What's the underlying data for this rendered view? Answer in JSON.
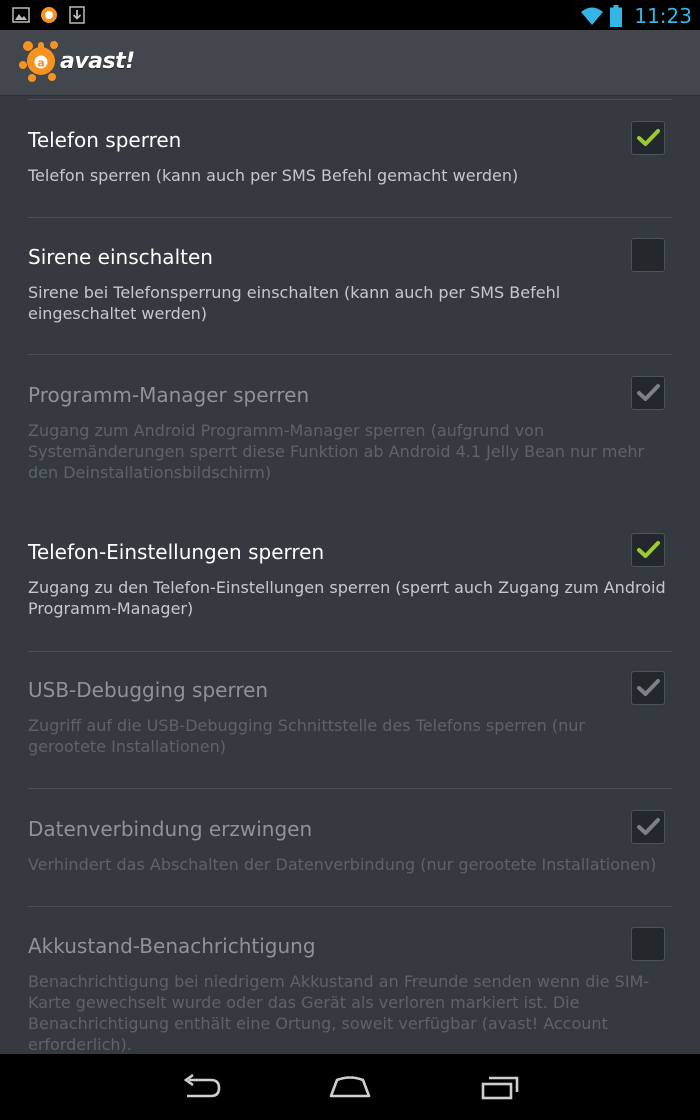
{
  "status_bar": {
    "time": "11:23",
    "left_icons": [
      "image-icon",
      "avast-notification-icon",
      "download-icon"
    ],
    "right_icons": [
      "wifi-icon",
      "battery-icon"
    ],
    "time_color": "#33b5e5"
  },
  "action_bar": {
    "app_name": "avast!",
    "logo_icon": "avast-logo-icon",
    "brand_color": "#f7931e"
  },
  "settings": [
    {
      "title": "Telefon sperren",
      "summary": "Telefon sperren (kann auch per SMS Befehl gemacht werden)",
      "checked": true,
      "enabled": true
    },
    {
      "title": "Sirene einschalten",
      "summary": "Sirene bei Telefonsperrung einschalten (kann auch per SMS Befehl eingeschaltet werden)",
      "checked": false,
      "enabled": true
    },
    {
      "title": "Programm-Manager sperren",
      "summary": "Zugang zum Android Programm-Manager sperren (aufgrund von Systemänderungen sperrt diese Funktion ab Android 4.1 Jelly Bean nur mehr den Deinstallationsbildschirm)",
      "checked": true,
      "enabled": false
    },
    {
      "title": "Telefon-Einstellungen sperren",
      "summary": "Zugang zu den Telefon-Einstellungen sperren (sperrt auch Zugang zum Android Programm-Manager)",
      "checked": true,
      "enabled": true
    },
    {
      "title": "USB-Debugging sperren",
      "summary": "Zugriff auf die USB-Debugging Schnittstelle des Telefons sperren (nur gerootete Installationen)",
      "checked": true,
      "enabled": false
    },
    {
      "title": "Datenverbindung erzwingen",
      "summary": "Verhindert das Abschalten der Datenverbindung (nur gerootete Installationen)",
      "checked": true,
      "enabled": false
    },
    {
      "title": "Akkustand-Benachrichtigung",
      "summary": "Benachrichtigung bei niedrigem Akkustand an Freunde senden wenn die SIM-Karte gewechselt wurde oder das Gerät als verloren markiert ist. Die Benachrichtigung enthält eine Ortung, soweit verfügbar (avast! Account erforderlich).",
      "checked": false,
      "enabled": false
    }
  ],
  "colors": {
    "check_enabled": "#99cc33",
    "check_disabled": "#7b8186"
  },
  "nav_bar": {
    "buttons": [
      "back-icon",
      "home-icon",
      "recent-apps-icon"
    ]
  }
}
